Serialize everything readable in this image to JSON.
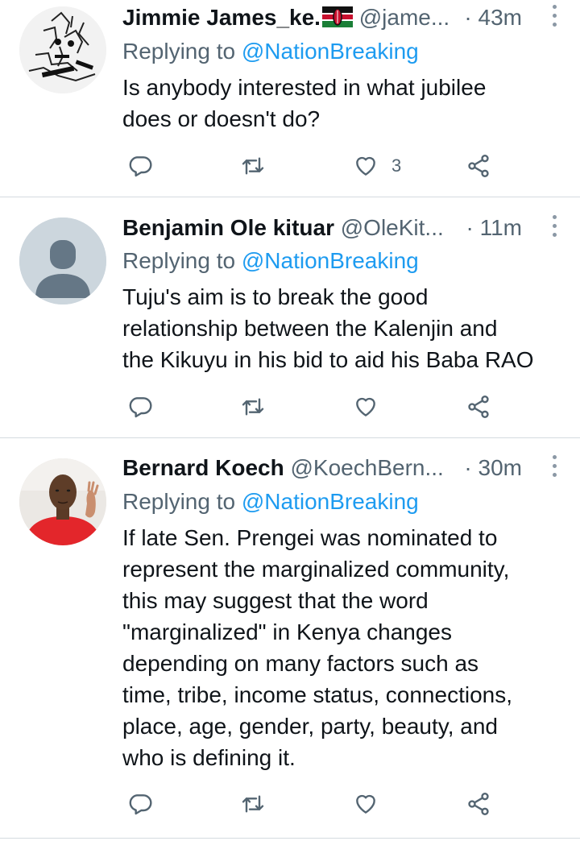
{
  "tweets": [
    {
      "display_name": "Jimmie James_ke.",
      "handle": "@jame...",
      "time": "· 43m",
      "replying_prefix": "Replying to ",
      "replying_to": "@NationBreaking",
      "text_lines": [
        "Is anybody interested in what jubilee",
        "does or doesn't do?"
      ],
      "likes": "3",
      "avatar": "sketch-portrait",
      "flag": "kenya-flag-emoji"
    },
    {
      "display_name": "Benjamin Ole kituar",
      "handle": "@OleKit...",
      "time": "· 11m",
      "replying_prefix": "Replying to ",
      "replying_to": "@NationBreaking",
      "text_lines": [
        "Tuju's aim is to break the good",
        "relationship between the Kalenjin and",
        "the Kikuyu in his bid to aid his Baba RAO"
      ],
      "likes": "",
      "avatar": "default-profile"
    },
    {
      "display_name": "Bernard Koech",
      "handle": "@KoechBern...",
      "time": "· 30m",
      "replying_prefix": "Replying to ",
      "replying_to": "@NationBreaking",
      "text_lines": [
        "If late Sen. Prengei was nominated to",
        "represent the marginalized community,",
        "this may suggest that the word",
        "\"marginalized\" in Kenya changes",
        "depending on many factors such as",
        "time, tribe, income status, connections,",
        "place, age, gender, party, beauty, and",
        "who is defining it."
      ],
      "likes": "",
      "avatar": "photo-person-red-shirt"
    }
  ],
  "icons": [
    "reply-icon",
    "retweet-icon",
    "like-icon",
    "share-icon",
    "more-icon"
  ],
  "colors": {
    "link": "#1d9bf0",
    "secondary": "#536471",
    "text": "#0f1419",
    "divider": "#d5dbe0"
  }
}
